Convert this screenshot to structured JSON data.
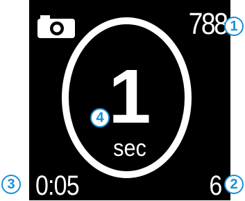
{
  "header": {
    "mode_icon": "camera-icon",
    "shot_count": "788"
  },
  "timer": {
    "interval_value": "1",
    "interval_unit": "sec"
  },
  "footer": {
    "elapsed_time": "0:05",
    "remaining_count": "6"
  },
  "callouts": [
    "1",
    "2",
    "3",
    "4"
  ],
  "colors": {
    "screen_background": "#000000",
    "foreground": "#ffffff",
    "callout_accent": "#1a8fd6"
  }
}
